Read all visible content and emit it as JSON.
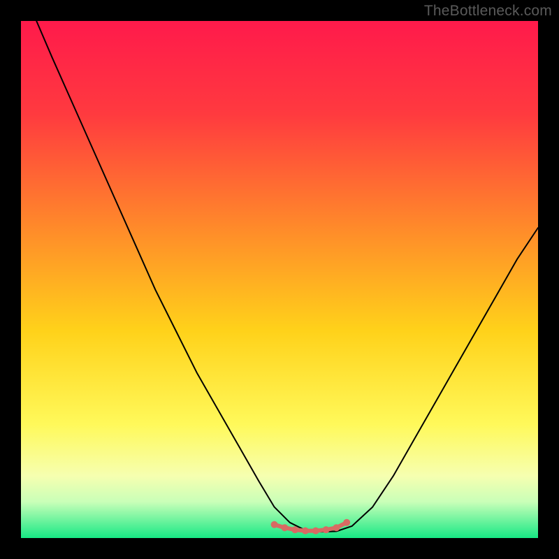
{
  "watermark": "TheBottleneck.com",
  "chart_data": {
    "type": "line",
    "title": "",
    "xlabel": "",
    "ylabel": "",
    "xlim": [
      0,
      100
    ],
    "ylim": [
      0,
      100
    ],
    "background_gradient": {
      "stops": [
        {
          "offset": 0.0,
          "color": "#ff1a4b"
        },
        {
          "offset": 0.18,
          "color": "#ff3a3f"
        },
        {
          "offset": 0.4,
          "color": "#ff8a2a"
        },
        {
          "offset": 0.6,
          "color": "#ffd21a"
        },
        {
          "offset": 0.78,
          "color": "#fff95a"
        },
        {
          "offset": 0.88,
          "color": "#f6ffb0"
        },
        {
          "offset": 0.93,
          "color": "#c9ffb8"
        },
        {
          "offset": 0.97,
          "color": "#63f29b"
        },
        {
          "offset": 1.0,
          "color": "#17e884"
        }
      ]
    },
    "series": [
      {
        "name": "curve",
        "color": "#000000",
        "width": 2,
        "x": [
          3,
          6,
          10,
          14,
          18,
          22,
          26,
          30,
          34,
          38,
          42,
          46,
          49,
          52,
          55,
          58,
          61,
          64,
          68,
          72,
          76,
          80,
          84,
          88,
          92,
          96,
          100
        ],
        "y": [
          100,
          93,
          84,
          75,
          66,
          57,
          48,
          40,
          32,
          25,
          18,
          11,
          6,
          3,
          1.5,
          1.2,
          1.3,
          2.3,
          6,
          12,
          19,
          26,
          33,
          40,
          47,
          54,
          60
        ]
      },
      {
        "name": "optimum-dots",
        "type": "scatter",
        "color": "#d86a63",
        "radius": 5,
        "x": [
          49,
          51,
          53,
          55,
          57,
          59,
          61,
          63
        ],
        "y": [
          2.6,
          2.0,
          1.6,
          1.4,
          1.4,
          1.6,
          2.0,
          3.0
        ]
      },
      {
        "name": "optimum-band",
        "type": "line",
        "color": "#d86a63",
        "width": 6,
        "x": [
          49,
          51,
          53,
          55,
          57,
          59,
          61,
          63
        ],
        "y": [
          2.6,
          2.0,
          1.6,
          1.4,
          1.4,
          1.6,
          2.0,
          3.0
        ]
      }
    ]
  }
}
